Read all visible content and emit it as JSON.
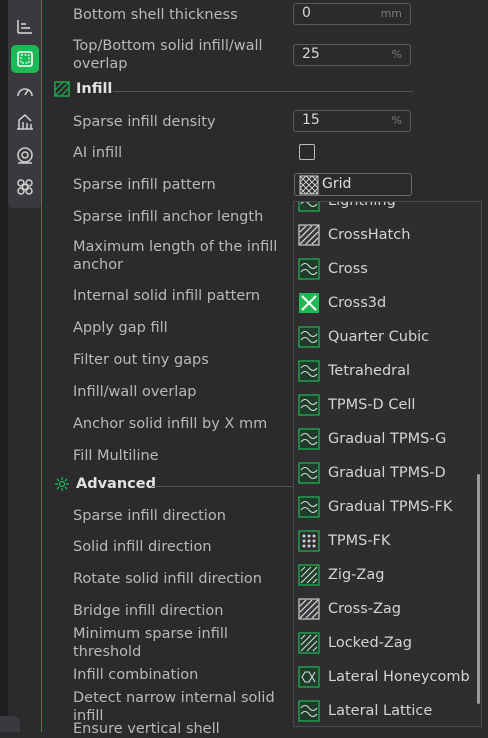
{
  "rail": {
    "icons": [
      "layers-icon",
      "infill-icon",
      "speed-icon",
      "support-icon",
      "filament-icon",
      "others-icon"
    ]
  },
  "rows_top": [
    {
      "label": "Bottom shell thickness",
      "value": "0",
      "unit": "mm"
    },
    {
      "label": "Top/Bottom solid infill/wall overlap",
      "value": "25",
      "unit": "%"
    }
  ],
  "infill_section": {
    "title": "Infill"
  },
  "sparse_density": {
    "label": "Sparse infill density",
    "value": "15",
    "unit": "%"
  },
  "ai_infill": {
    "label": "AI infill"
  },
  "sparse_pattern": {
    "label": "Sparse infill pattern",
    "value": "Grid"
  },
  "labels_infill": [
    "Sparse infill anchor length",
    "Maximum length of the infill anchor",
    "Internal solid infill pattern",
    "Apply gap fill",
    "Filter out tiny gaps",
    "Infill/wall overlap",
    "Anchor solid infill by X mm",
    "Fill Multiline"
  ],
  "advanced_section": {
    "title": "Advanced"
  },
  "labels_advanced": [
    "Sparse infill direction",
    "Solid infill direction",
    "Rotate solid infill direction",
    "Bridge infill direction",
    "Minimum sparse infill threshold",
    "Infill combination",
    "Detect narrow internal solid infill",
    "Ensure vertical shell"
  ],
  "dropdown": {
    "items": [
      "Lightning",
      "CrossHatch",
      "Cross",
      "Cross3d",
      "Quarter Cubic",
      "Tetrahedral",
      "TPMS-D Cell",
      "Gradual TPMS-G",
      "Gradual TPMS-D",
      "Gradual TPMS-FK",
      "TPMS-FK",
      "Zig-Zag",
      "Cross-Zag",
      "Locked-Zag",
      "Lateral Honeycomb",
      "Lateral Lattice"
    ]
  },
  "colors": {
    "accent": "#1db954",
    "bg": "#2b2b2e",
    "rail": "#3a3a3e"
  }
}
